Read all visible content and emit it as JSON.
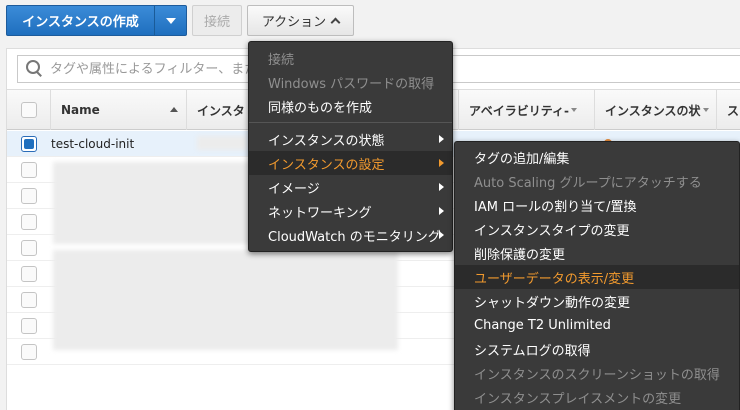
{
  "toolbar": {
    "launch_label": "インスタンスの作成",
    "connect_label": "接続",
    "actions_label": "アクション"
  },
  "filter": {
    "placeholder": "タグや属性によるフィルター、また"
  },
  "table": {
    "columns": {
      "name": "Name",
      "instance_id": "インスタ",
      "az": "アベイラビリティ-",
      "instance_state": "インスタンスの状",
      "status": "ス"
    },
    "rows": [
      {
        "name": "test-cloud-init",
        "selected": true
      }
    ]
  },
  "actions_menu": {
    "items": [
      {
        "label": "接続",
        "disabled": true
      },
      {
        "label": "Windows パスワードの取得",
        "disabled": true
      },
      {
        "label": "同様のものを作成",
        "disabled": false
      },
      {
        "label": "インスタンスの状態",
        "submenu": true
      },
      {
        "label": "インスタンスの設定",
        "submenu": true,
        "active": true
      },
      {
        "label": "イメージ",
        "submenu": true
      },
      {
        "label": "ネットワーキング",
        "submenu": true
      },
      {
        "label": "CloudWatch のモニタリング",
        "submenu": true
      }
    ]
  },
  "settings_submenu": {
    "items": [
      {
        "label": "タグの追加/編集",
        "disabled": false
      },
      {
        "label": "Auto Scaling グループにアタッチする",
        "disabled": true
      },
      {
        "label": "IAM ロールの割り当て/置換",
        "disabled": false
      },
      {
        "label": "インスタンスタイプの変更",
        "disabled": false
      },
      {
        "label": "削除保護の変更",
        "disabled": false
      },
      {
        "label": "ユーザーデータの表示/変更",
        "disabled": false,
        "active": true
      },
      {
        "label": "シャットダウン動作の変更",
        "disabled": false
      },
      {
        "label": "Change T2 Unlimited",
        "disabled": false
      },
      {
        "label": "システムログの取得",
        "disabled": false
      },
      {
        "label": "インスタンスのスクリーンショットの取得",
        "disabled": true
      },
      {
        "label": "インスタンスプレイスメントの変更",
        "disabled": true
      }
    ]
  },
  "colors": {
    "primary": "#1f6fbe",
    "menu_bg": "#3a3a3a",
    "menu_active_text": "#f29a2e",
    "menu_disabled_text": "#8f8f8f"
  }
}
